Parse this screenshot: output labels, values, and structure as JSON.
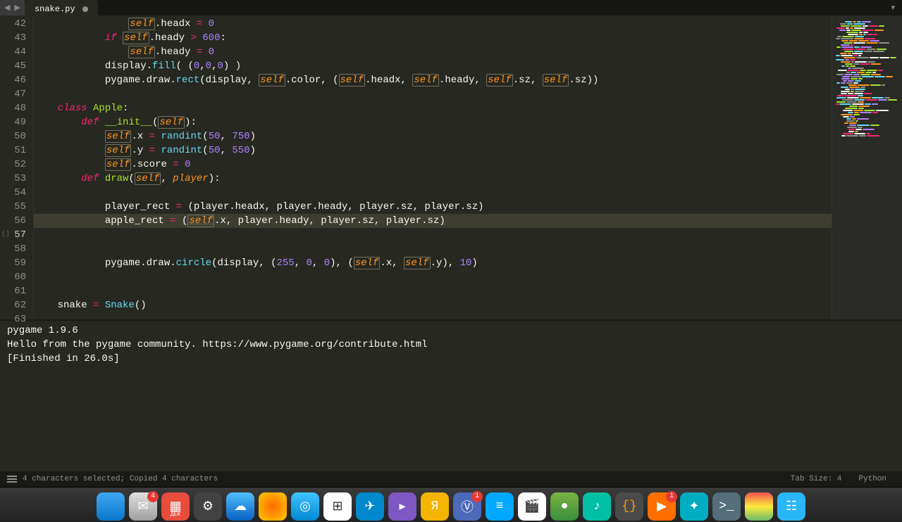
{
  "tab": {
    "filename": "snake.py",
    "dirty_marker": "●"
  },
  "menu_trigger": "▾",
  "nav": {
    "back": "◀",
    "forward": "▶"
  },
  "line_numbers": [
    "42",
    "43",
    "44",
    "45",
    "46",
    "47",
    "48",
    "49",
    "50",
    "51",
    "52",
    "53",
    "54",
    "55",
    "56",
    "57",
    "58",
    "59",
    "60",
    "61",
    "62",
    "63"
  ],
  "current_line_index": 15,
  "code_lines": [
    {
      "segs": [
        {
          "t": "                ",
          "c": "p"
        },
        {
          "t": "self",
          "c": "s boxed"
        },
        {
          "t": ".headx ",
          "c": "p"
        },
        {
          "t": "=",
          "c": "op"
        },
        {
          "t": " ",
          "c": "p"
        },
        {
          "t": "0",
          "c": "n"
        }
      ]
    },
    {
      "segs": [
        {
          "t": "            ",
          "c": "p"
        },
        {
          "t": "if",
          "c": "k"
        },
        {
          "t": " ",
          "c": "p"
        },
        {
          "t": "self",
          "c": "s boxed"
        },
        {
          "t": ".heady ",
          "c": "p"
        },
        {
          "t": ">",
          "c": "op"
        },
        {
          "t": " ",
          "c": "p"
        },
        {
          "t": "600",
          "c": "n"
        },
        {
          "t": ":",
          "c": "p"
        }
      ]
    },
    {
      "segs": [
        {
          "t": "                ",
          "c": "p"
        },
        {
          "t": "self",
          "c": "s boxed"
        },
        {
          "t": ".heady ",
          "c": "p"
        },
        {
          "t": "=",
          "c": "op"
        },
        {
          "t": " ",
          "c": "p"
        },
        {
          "t": "0",
          "c": "n"
        }
      ]
    },
    {
      "segs": [
        {
          "t": "            display.",
          "c": "p"
        },
        {
          "t": "fill",
          "c": "fn"
        },
        {
          "t": "( (",
          "c": "p"
        },
        {
          "t": "0",
          "c": "n"
        },
        {
          "t": ",",
          "c": "p"
        },
        {
          "t": "0",
          "c": "n"
        },
        {
          "t": ",",
          "c": "p"
        },
        {
          "t": "0",
          "c": "n"
        },
        {
          "t": ") )",
          "c": "p"
        }
      ]
    },
    {
      "segs": [
        {
          "t": "            pygame.draw.",
          "c": "p"
        },
        {
          "t": "rect",
          "c": "fn"
        },
        {
          "t": "(display, ",
          "c": "p"
        },
        {
          "t": "self",
          "c": "s boxed"
        },
        {
          "t": ".color, (",
          "c": "p"
        },
        {
          "t": "self",
          "c": "s boxed"
        },
        {
          "t": ".headx, ",
          "c": "p"
        },
        {
          "t": "self",
          "c": "s boxed"
        },
        {
          "t": ".heady, ",
          "c": "p"
        },
        {
          "t": "self",
          "c": "s boxed"
        },
        {
          "t": ".sz, ",
          "c": "p"
        },
        {
          "t": "self",
          "c": "s boxed"
        },
        {
          "t": ".sz))",
          "c": "p"
        }
      ]
    },
    {
      "segs": []
    },
    {
      "segs": [
        {
          "t": "    ",
          "c": "p"
        },
        {
          "t": "class",
          "c": "k"
        },
        {
          "t": " ",
          "c": "p"
        },
        {
          "t": "Apple",
          "c": "cls"
        },
        {
          "t": ":",
          "c": "p"
        }
      ]
    },
    {
      "segs": [
        {
          "t": "        ",
          "c": "p"
        },
        {
          "t": "def",
          "c": "k"
        },
        {
          "t": " ",
          "c": "p"
        },
        {
          "t": "__init__",
          "c": "fname"
        },
        {
          "t": "(",
          "c": "p"
        },
        {
          "t": "self",
          "c": "s boxed"
        },
        {
          "t": "):",
          "c": "p"
        }
      ]
    },
    {
      "segs": [
        {
          "t": "            ",
          "c": "p"
        },
        {
          "t": "self",
          "c": "s boxed"
        },
        {
          "t": ".x ",
          "c": "p"
        },
        {
          "t": "=",
          "c": "op"
        },
        {
          "t": " ",
          "c": "p"
        },
        {
          "t": "randint",
          "c": "fn"
        },
        {
          "t": "(",
          "c": "p"
        },
        {
          "t": "50",
          "c": "n"
        },
        {
          "t": ", ",
          "c": "p"
        },
        {
          "t": "750",
          "c": "n"
        },
        {
          "t": ")",
          "c": "p"
        }
      ]
    },
    {
      "segs": [
        {
          "t": "            ",
          "c": "p"
        },
        {
          "t": "self",
          "c": "s boxed"
        },
        {
          "t": ".y ",
          "c": "p"
        },
        {
          "t": "=",
          "c": "op"
        },
        {
          "t": " ",
          "c": "p"
        },
        {
          "t": "randint",
          "c": "fn"
        },
        {
          "t": "(",
          "c": "p"
        },
        {
          "t": "50",
          "c": "n"
        },
        {
          "t": ", ",
          "c": "p"
        },
        {
          "t": "550",
          "c": "n"
        },
        {
          "t": ")",
          "c": "p"
        }
      ]
    },
    {
      "segs": [
        {
          "t": "            ",
          "c": "p"
        },
        {
          "t": "self",
          "c": "s boxed"
        },
        {
          "t": ".score ",
          "c": "p"
        },
        {
          "t": "=",
          "c": "op"
        },
        {
          "t": " ",
          "c": "p"
        },
        {
          "t": "0",
          "c": "n"
        }
      ]
    },
    {
      "segs": [
        {
          "t": "        ",
          "c": "p"
        },
        {
          "t": "def",
          "c": "k"
        },
        {
          "t": " ",
          "c": "p"
        },
        {
          "t": "draw",
          "c": "fname"
        },
        {
          "t": "(",
          "c": "p"
        },
        {
          "t": "self",
          "c": "s boxed"
        },
        {
          "t": ", ",
          "c": "p"
        },
        {
          "t": "player",
          "c": "s"
        },
        {
          "t": "):",
          "c": "p"
        }
      ]
    },
    {
      "segs": []
    },
    {
      "segs": [
        {
          "t": "            player_rect ",
          "c": "p"
        },
        {
          "t": "=",
          "c": "op"
        },
        {
          "t": " (player.headx, player.heady, player.sz, player.sz)",
          "c": "p"
        }
      ]
    },
    {
      "segs": [
        {
          "t": "            apple_rect ",
          "c": "p"
        },
        {
          "t": "=",
          "c": "op"
        },
        {
          "t": " ",
          "c": "p"
        },
        {
          "t": "(",
          "c": "p underline"
        },
        {
          "t": "self",
          "c": "s boxed underline"
        },
        {
          "t": ".x, player.heady, player.sz, player.sz",
          "c": "p"
        },
        {
          "t": ")",
          "c": "p underline"
        }
      ],
      "hl": true
    },
    {
      "segs": []
    },
    {
      "segs": []
    },
    {
      "segs": [
        {
          "t": "            pygame.draw.",
          "c": "p"
        },
        {
          "t": "circle",
          "c": "fn"
        },
        {
          "t": "(display, (",
          "c": "p"
        },
        {
          "t": "255",
          "c": "n"
        },
        {
          "t": ", ",
          "c": "p"
        },
        {
          "t": "0",
          "c": "n"
        },
        {
          "t": ", ",
          "c": "p"
        },
        {
          "t": "0",
          "c": "n"
        },
        {
          "t": "), (",
          "c": "p"
        },
        {
          "t": "self",
          "c": "s boxed"
        },
        {
          "t": ".x, ",
          "c": "p"
        },
        {
          "t": "self",
          "c": "s boxed"
        },
        {
          "t": ".y), ",
          "c": "p"
        },
        {
          "t": "10",
          "c": "n"
        },
        {
          "t": ")",
          "c": "p"
        }
      ]
    },
    {
      "segs": []
    },
    {
      "segs": []
    },
    {
      "segs": [
        {
          "t": "    snake ",
          "c": "p"
        },
        {
          "t": "=",
          "c": "op"
        },
        {
          "t": " ",
          "c": "p"
        },
        {
          "t": "Snake",
          "c": "fn"
        },
        {
          "t": "()",
          "c": "p"
        }
      ]
    }
  ],
  "output": [
    "pygame 1.9.6",
    "Hello from the pygame community. https://www.pygame.org/contribute.html",
    "[Finished in 26.0s]"
  ],
  "status": {
    "left": "4 characters selected; Copied 4 characters",
    "tab_size": "Tab Size: 4",
    "syntax": "Python"
  },
  "dock_badges": {
    "mail": "4",
    "vk": "1",
    "browser": "1"
  },
  "dock_icons": [
    {
      "bg": "linear-gradient(#3fa9f5,#0b75c9)",
      "glyph": ""
    },
    {
      "bg": "linear-gradient(#e0e0e0,#a0a0a0)",
      "glyph": "✉",
      "badge": "mail"
    },
    {
      "bg": "#e74c3c",
      "glyph": "▦",
      "label": "ДЕК"
    },
    {
      "bg": "#424242",
      "glyph": "⚙"
    },
    {
      "bg": "linear-gradient(#50bfff,#0a60c2)",
      "glyph": "☁"
    },
    {
      "bg": "radial-gradient(#ff6a00,#ffcc00)",
      "glyph": ""
    },
    {
      "bg": "linear-gradient(#40c4ff,#0288d1)",
      "glyph": "◎"
    },
    {
      "bg": "#fff",
      "glyph": "⊞",
      "fg": "#333"
    },
    {
      "bg": "#0088cc",
      "glyph": "✈"
    },
    {
      "bg": "#7e57c2",
      "glyph": "▸"
    },
    {
      "bg": "#f4b400",
      "glyph": "Я"
    },
    {
      "bg": "#4c69ba",
      "glyph": "Ⓥ",
      "badge": "vk"
    },
    {
      "bg": "#00a8ff",
      "glyph": "≡"
    },
    {
      "bg": "#fff",
      "glyph": "🎬",
      "fg": "#333"
    },
    {
      "bg": "linear-gradient(#7cb342,#388e3c)",
      "glyph": "●"
    },
    {
      "bg": "#00bfa5",
      "glyph": "♪"
    },
    {
      "bg": "#4a4a4a",
      "glyph": "{}",
      "fg": "#ff9800"
    },
    {
      "bg": "#ff6f00",
      "glyph": "▶",
      "badge": "browser"
    },
    {
      "bg": "#00acc1",
      "glyph": "✦"
    },
    {
      "bg": "#546e7a",
      "glyph": ">_"
    },
    {
      "bg": "linear-gradient(#ef5350,#ffeb3b,#66bb6a)",
      "glyph": ""
    },
    {
      "bg": "#29b6f6",
      "glyph": "☷"
    }
  ]
}
